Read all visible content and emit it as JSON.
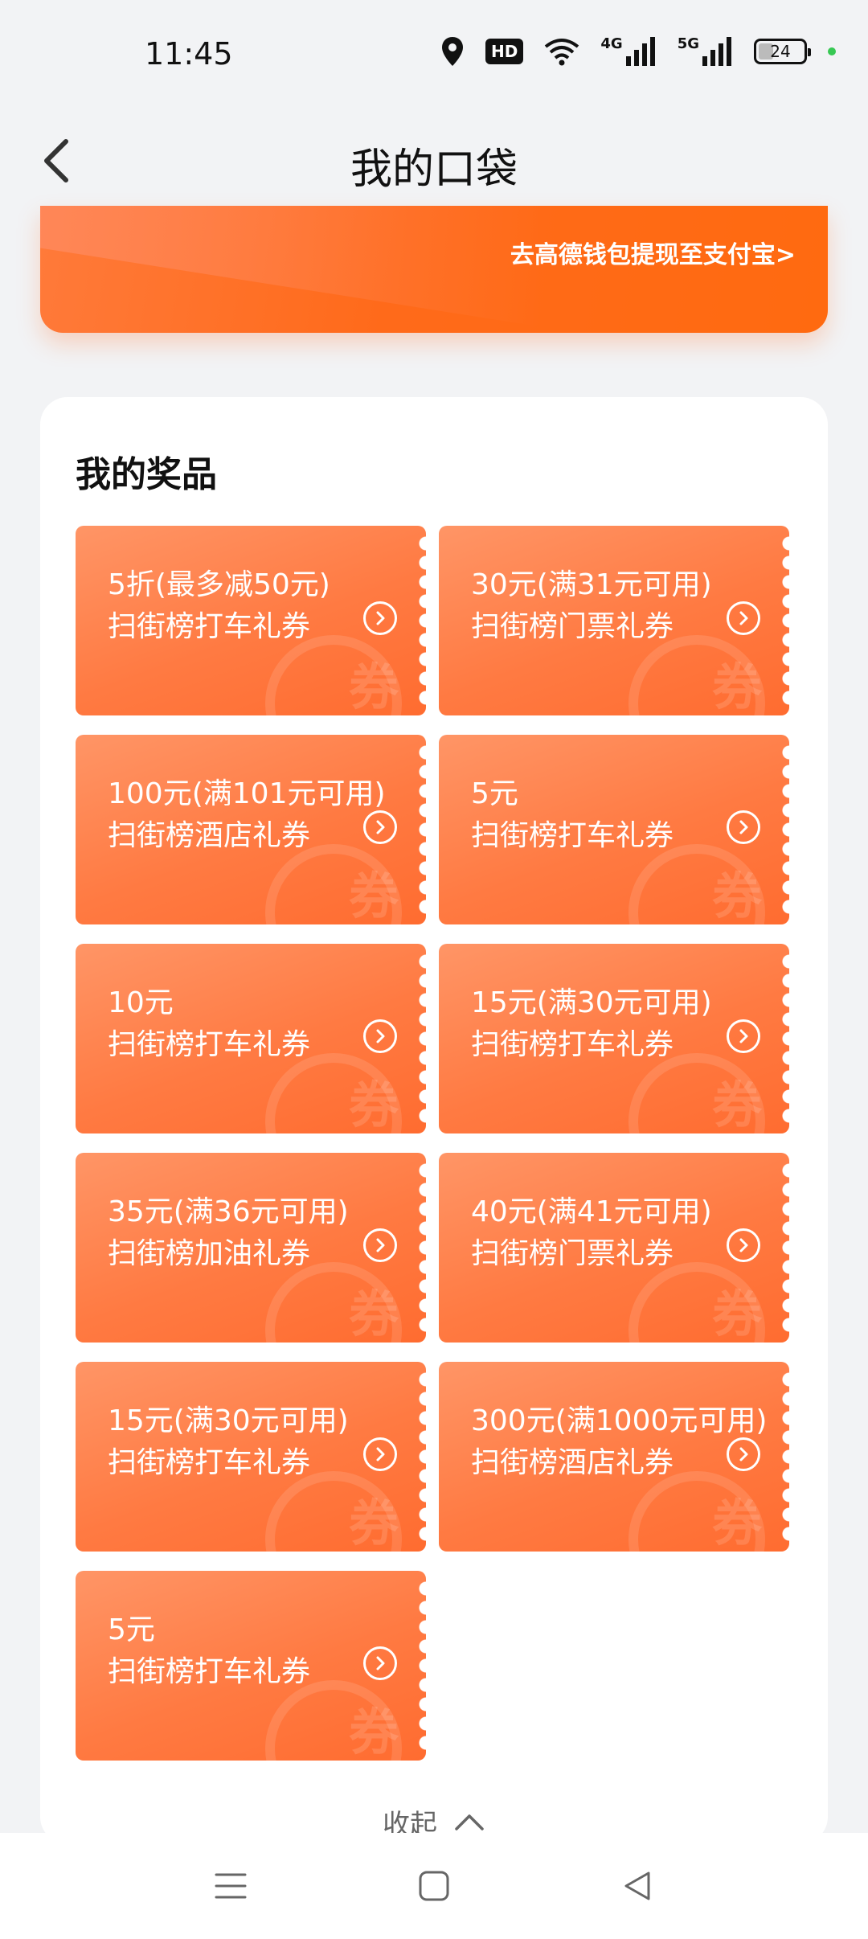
{
  "status_bar": {
    "time": "11:45",
    "hd_label": "HD",
    "net1": "4G",
    "net2": "5G",
    "battery": "24"
  },
  "header": {
    "title": "我的口袋"
  },
  "banner": {
    "link_text": "去高德钱包提现至支付宝>"
  },
  "prizes": {
    "title": "我的奖品",
    "watermark": "券",
    "items": [
      {
        "line1": "5折(最多减50元)",
        "line2": "扫街榜打车礼券"
      },
      {
        "line1": "30元(满31元可用)",
        "line2": "扫街榜门票礼券"
      },
      {
        "line1": "100元(满101元可用)",
        "line2": "扫街榜酒店礼券"
      },
      {
        "line1": "5元",
        "line2": "扫街榜打车礼券"
      },
      {
        "line1": "10元",
        "line2": "扫街榜打车礼券"
      },
      {
        "line1": "15元(满30元可用)",
        "line2": "扫街榜打车礼券"
      },
      {
        "line1": "35元(满36元可用)",
        "line2": "扫街榜加油礼券"
      },
      {
        "line1": "40元(满41元可用)",
        "line2": "扫街榜门票礼券"
      },
      {
        "line1": "15元(满30元可用)",
        "line2": "扫街榜打车礼券"
      },
      {
        "line1": "300元(满1000元可用)",
        "line2": "扫街榜酒店礼券"
      },
      {
        "line1": "5元",
        "line2": "扫街榜打车礼券"
      }
    ],
    "collapse_label": "收起"
  },
  "icons": {
    "back": "chevron-left-icon",
    "location": "location-pin-icon",
    "wifi": "wifi-icon",
    "signal": "signal-icon",
    "battery": "battery-icon",
    "coupon_go": "circle-chevron-right-icon",
    "collapse": "chevron-up-icon",
    "nav_menu": "menu-icon",
    "nav_home": "home-square-icon",
    "nav_back": "triangle-back-icon"
  },
  "colors": {
    "accent": "#ff6a1a",
    "coupon_start": "#ff9566",
    "coupon_end": "#ff6c30"
  }
}
